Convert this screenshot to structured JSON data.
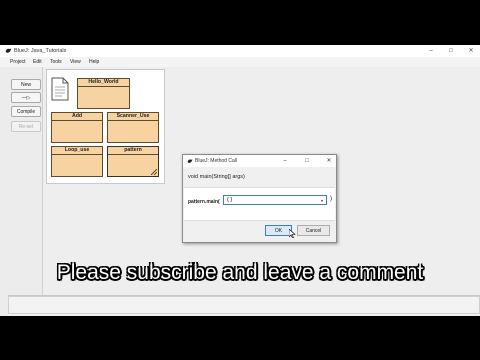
{
  "window": {
    "title": "BlueJ: Java_Tutorials",
    "minimize_glyph": "–",
    "maximize_glyph": "□",
    "close_glyph": "✕"
  },
  "menu": [
    "Project",
    "Edit",
    "Tools",
    "View",
    "Help"
  ],
  "sidebar": {
    "new_class": "New Class...",
    "arrow_glyph": "—▷",
    "compile": "Compile",
    "reset": "Re-set"
  },
  "classes": [
    {
      "name": "Hello_World",
      "double_border": false
    },
    {
      "name": "Add",
      "double_border": false
    },
    {
      "name": "Scanner_Use",
      "double_border": false
    },
    {
      "name": "Loop_use",
      "double_border": false
    },
    {
      "name": "pattern",
      "double_border": true
    }
  ],
  "dialog": {
    "title": "BlueJ: Method Call",
    "signature": "void main(String[] args)",
    "call_label": "pattern.main(",
    "input_value": "{ }",
    "close_paren": ")",
    "dropdown_glyph": "▾",
    "ok": "OK",
    "cancel": "Cancel",
    "minimize_glyph": "–",
    "maximize_glyph": "□",
    "close_glyph": "✕"
  },
  "subtitle": "Please subscribe and leave a comment",
  "colors": {
    "class_fill": "#f7d3a1",
    "class_border": "#5a4a30",
    "accent": "#3d7cc9"
  }
}
